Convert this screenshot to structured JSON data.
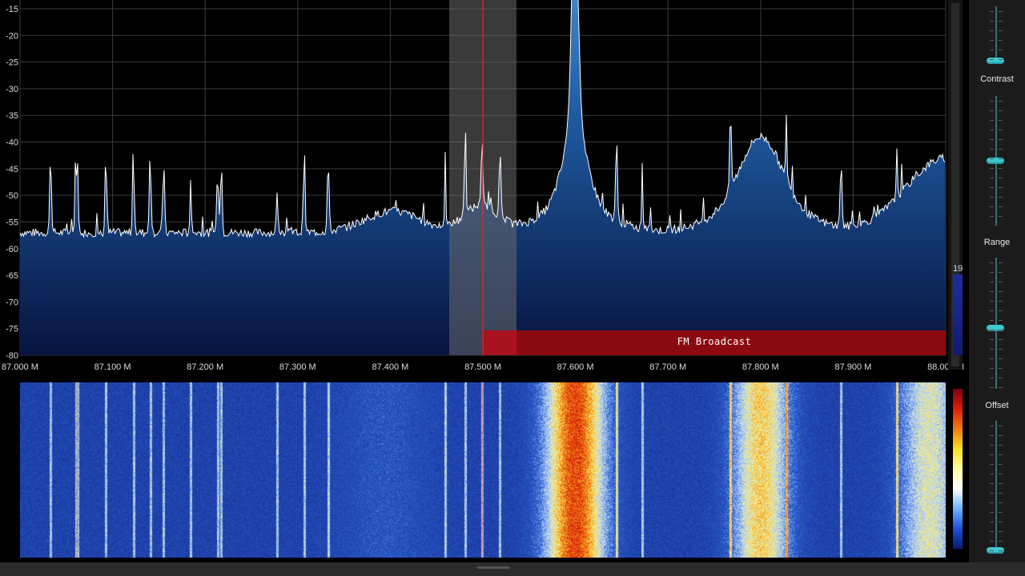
{
  "spectrum": {
    "db_ticks": [
      "-15",
      "-20",
      "-25",
      "-30",
      "-35",
      "-40",
      "-45",
      "-50",
      "-55",
      "-60",
      "-65",
      "-70",
      "-75",
      "-80"
    ],
    "freq_ticks": [
      "87.000 M",
      "87.100 M",
      "87.200 M",
      "87.300 M",
      "87.400 M",
      "87.500 M",
      "87.600 M",
      "87.700 M",
      "87.800 M",
      "87.900 M",
      "88.000 M"
    ],
    "band_label": "FM Broadcast",
    "colors": {
      "background": "#000000",
      "grid": "#3a3a3a",
      "fill_top": "#3f8fd1",
      "fill_bottom": "#06103a",
      "trace": "#ffffff",
      "selection": "#5a5a5a",
      "tuning_line": "#ff2020",
      "band": "#8b0a12"
    }
  },
  "side_panel": {
    "contrast_label": "Contrast",
    "range_label": "Range",
    "offset_label": "Offset",
    "level_value": "19"
  }
}
